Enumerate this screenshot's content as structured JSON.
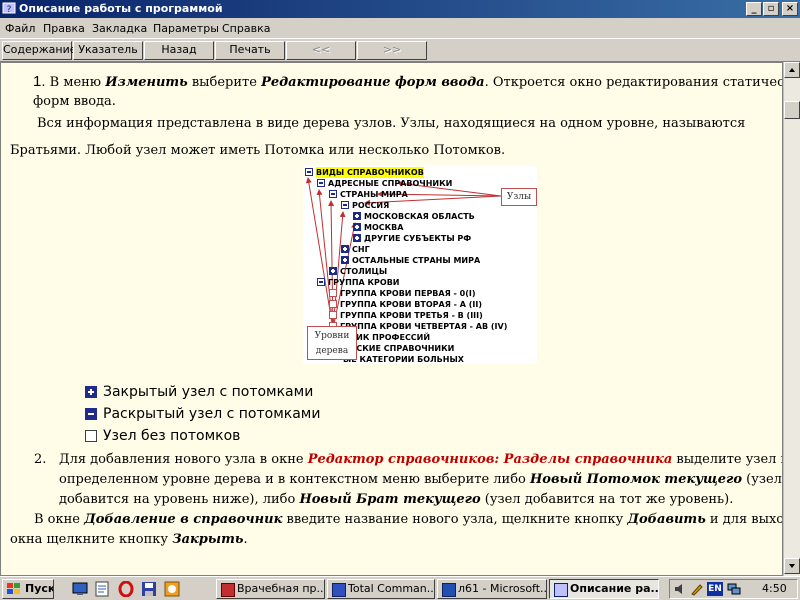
{
  "window": {
    "title": "Описание  работы с программой",
    "buttons": [
      "_",
      "▫",
      "×"
    ]
  },
  "menu": [
    "Файл",
    "Правка",
    "Закладка",
    "Параметры",
    "Справка"
  ],
  "toolbar": {
    "contents": "Содержание",
    "index": "Указатель",
    "back": "Назад",
    "print": "Печать",
    "prev": "<<",
    "next": ">>"
  },
  "content": {
    "p1": {
      "num": "1.",
      "t1": " В меню ",
      "b1": "Изменить",
      "t2": " выберите ",
      "b2": "Редактирование форм ввода",
      "t3": ". Откроется окно редактирования статических",
      "line2": "форм ввода."
    },
    "p2a": "Вся информация представлена в виде дерева узлов. Узлы, находящиеся на одном уровне, называются",
    "p2b": "Братьями. Любой узел может иметь Потомка или несколько Потомков.",
    "legend": [
      "Закрытый узел с потомками",
      "Раскрытый узел с потомками",
      "Узел без потомков"
    ],
    "item2": {
      "num": "2.",
      "l1_t1": "Для добавления нового узла в окне ",
      "l1_red": "Редактор справочников: Разделы справочника",
      "l1_t2": " выделите узел на",
      "l2_t1": "определенном уровне дерева и в контекстном меню выберите либо ",
      "l2_b1": "Новый Потомок текущего",
      "l2_t2": " (узел",
      "l3_t1": "добавится на уровень ниже), либо ",
      "l3_b1": "Новый Брат текущего",
      "l3_t2": " (узел добавится на тот же уровень)."
    },
    "p3": {
      "t1": "В окне ",
      "b1": "Добавление в справочник",
      "t2": " введите название нового узла, щелкните кнопку ",
      "b2": "Добавить",
      "t3": " и для выхода из",
      "l2_t1": "окна щелкните кнопку ",
      "l2_b1": "Закрыть",
      "l2_t2": "."
    }
  },
  "diagram": {
    "nodes": [
      "ВИДЫ СПРАВОЧНИКОВ",
      "АДРЕСНЫЕ СПРАВОЧНИКИ",
      "СТРАНЫ МИРА",
      "РОССИЯ",
      "МОСКОВСКАЯ ОБЛАСТЬ",
      "МОСКВА",
      "ДРУГИЕ СУБЪЕКТЫ РФ",
      "СНГ",
      "ОСТАЛЬНЫЕ СТРАНЫ МИРА",
      "СТОЛИЦЫ",
      "ГРУППА КРОВИ",
      "ГРУППА КРОВИ ПЕРВАЯ - 0(I)",
      "ГРУППА КРОВИ ВТОРАЯ - А (II)",
      "ГРУППА КРОВИ ТРЕТЬЯ - В (III)",
      "ГРУППА КРОВИ ЧЕТВЕРТАЯ - АВ (IV)",
      "ЧНИК ПРОФЕССИЙ",
      "ИНСКИЕ СПРАВОЧНИКИ",
      "ЫЕ КАТЕГОРИИ БОЛЬНЫХ"
    ],
    "label_nodes": "Узлы",
    "label_levels_1": "Уровни",
    "label_levels_2": "дерева"
  },
  "taskbar": {
    "start": "Пуск",
    "tasks": [
      "Врачебная пр...",
      "Total Comman...",
      "л61 - Microsoft...",
      "Описание  ра..."
    ],
    "lang": "EN",
    "time": "4:50"
  },
  "colors": {
    "title_start": "#0a246a",
    "title_end": "#3a6ea5",
    "content_bg": "#fffde7",
    "accent_red": "#c00000",
    "node_blue": "#1e2b8a"
  }
}
